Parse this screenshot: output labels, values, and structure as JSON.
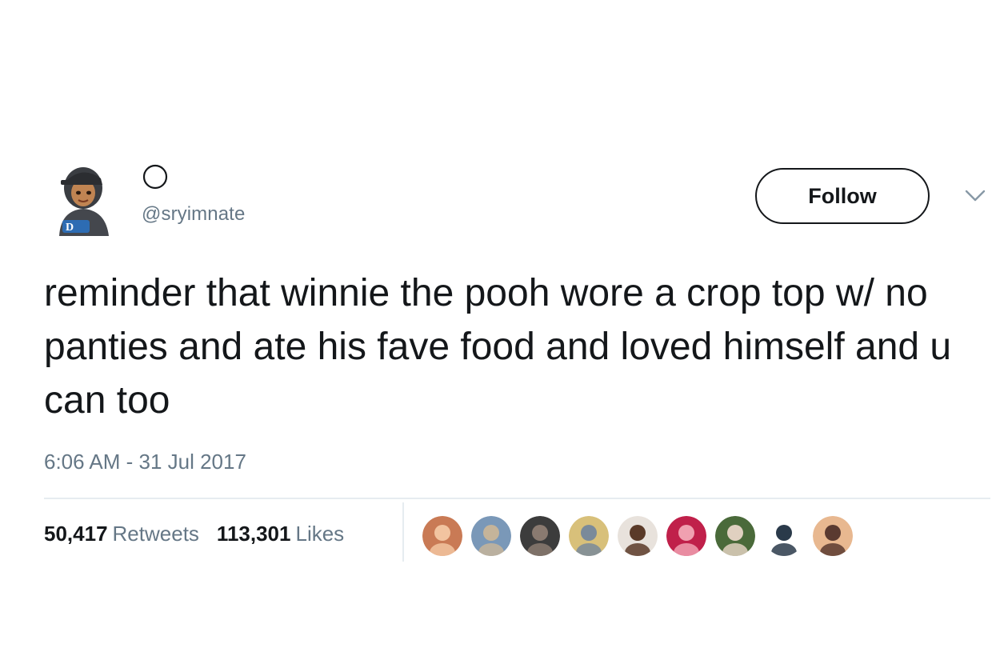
{
  "user": {
    "display_name": "",
    "handle": "@sryimnate"
  },
  "follow_button": {
    "label": "Follow"
  },
  "tweet": {
    "text": "reminder that winnie the pooh wore a crop top w/ no panties and ate his fave food and loved himself and u can too",
    "timestamp": "6:06 AM - 31 Jul 2017"
  },
  "stats": {
    "retweets_count": "50,417",
    "retweets_label": "Retweets",
    "likes_count": "113,301",
    "likes_label": "Likes"
  },
  "likers": [
    {
      "icon": "liker-avatar",
      "bg": "#c97a55",
      "fg": "#f2c4a0"
    },
    {
      "icon": "liker-avatar",
      "bg": "#7a98b8",
      "fg": "#c5b49a"
    },
    {
      "icon": "liker-avatar",
      "bg": "#3c3c3c",
      "fg": "#8a7a70"
    },
    {
      "icon": "liker-avatar",
      "bg": "#d8c07a",
      "fg": "#7a8a9a"
    },
    {
      "icon": "liker-avatar",
      "bg": "#e8e2dc",
      "fg": "#5a3a28"
    },
    {
      "icon": "liker-avatar",
      "bg": "#c0204a",
      "fg": "#f0a0b0"
    },
    {
      "icon": "liker-avatar",
      "bg": "#4a6a3a",
      "fg": "#e0d0c0"
    },
    {
      "icon": "liker-avatar",
      "bg": "#ffffff",
      "fg": "#2a3a4a"
    },
    {
      "icon": "liker-avatar",
      "bg": "#e8b890",
      "fg": "#5a3a30"
    }
  ],
  "colors": {
    "text": "#14171a",
    "secondary": "#657786",
    "divider": "#e6ecf0"
  }
}
